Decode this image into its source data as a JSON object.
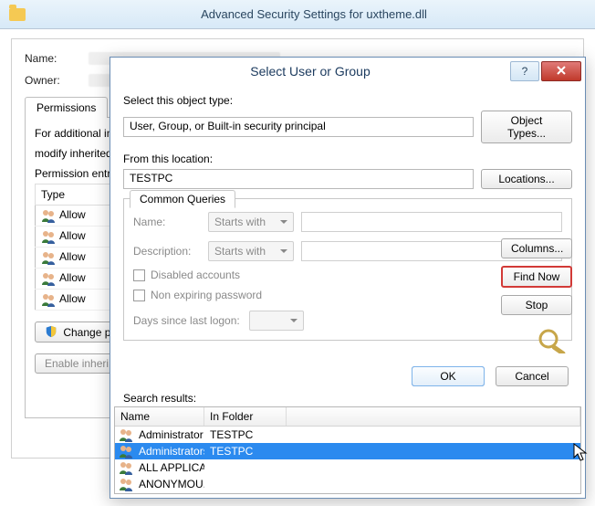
{
  "window_title": "Advanced Security Settings for uxtheme.dll",
  "asw": {
    "name_label": "Name:",
    "owner_label": "Owner:",
    "tab": "Permissions",
    "info1": "For additional in",
    "info2": "modify inherited",
    "entries_label": "Permission entri",
    "col_type": "Type",
    "rows": [
      "Allow",
      "Allow",
      "Allow",
      "Allow",
      "Allow"
    ],
    "change_btn": "Change pe",
    "enable_btn": "Enable inheri"
  },
  "dialog": {
    "title": "Select User or Group",
    "help": "?",
    "close": "X",
    "select_label": "Select this object type:",
    "object_type_value": "User, Group, or Built-in security principal",
    "object_types_btn": "Object Types...",
    "from_label": "From this location:",
    "location_value": "TESTPC",
    "locations_btn": "Locations...",
    "cq_tab": "Common Queries",
    "name_label": "Name:",
    "desc_label": "Description:",
    "starts_with": "Starts with",
    "disabled_accounts": "Disabled accounts",
    "non_expiring": "Non expiring password",
    "days_label": "Days since last logon:",
    "columns_btn": "Columns...",
    "find_now_btn": "Find Now",
    "stop_btn": "Stop",
    "ok_btn": "OK",
    "cancel_btn": "Cancel",
    "search_results_label": "Search results:",
    "results": {
      "col_name": "Name",
      "col_folder": "In Folder",
      "rows": [
        {
          "name": "Administrator",
          "folder": "TESTPC",
          "selected": false
        },
        {
          "name": "Administrators",
          "folder": "TESTPC",
          "selected": true
        },
        {
          "name": "ALL APPLICA...",
          "folder": "",
          "selected": false
        },
        {
          "name": "ANONYMOU...",
          "folder": "",
          "selected": false
        }
      ]
    }
  }
}
